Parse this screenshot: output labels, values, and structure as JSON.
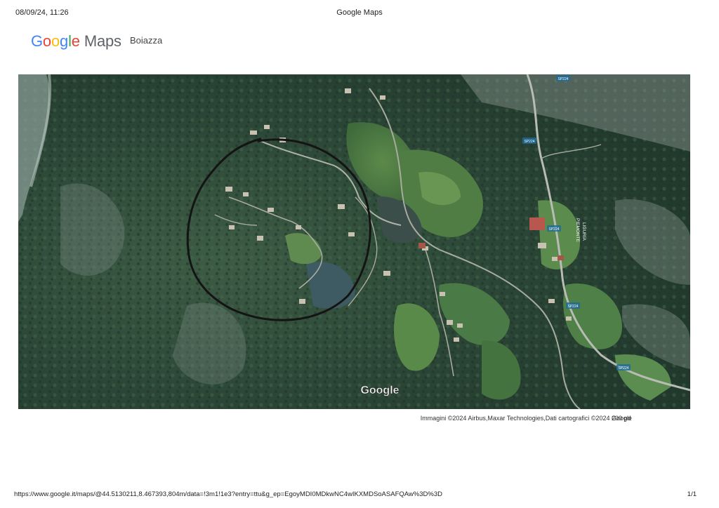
{
  "print_header": {
    "datetime": "08/09/24, 11:26",
    "title": "Google Maps"
  },
  "logo": {
    "letters": [
      "G",
      "o",
      "o",
      "g",
      "l",
      "e"
    ],
    "colors": [
      "#4285F4",
      "#EA4335",
      "#FBBC05",
      "#4285F4",
      "#34A853",
      "#EA4335"
    ],
    "maps_label": "Maps"
  },
  "place_name": "Boiazza",
  "map": {
    "watermark": "Google",
    "road_labels": [
      "SP224",
      "SP224",
      "SP224",
      "SP224",
      "SP224"
    ],
    "region_label": [
      "PIEMONTE",
      "LIGURIA"
    ],
    "marked_area": "hand-drawn circle"
  },
  "attribution": "Immagini ©2024 Airbus,Maxar Technologies,Dati cartografici ©2024 Google",
  "scale_label": "200 pd",
  "footer": {
    "url": "https://www.google.it/maps/@44.5130211,8.467393,804m/data=!3m1!1e3?entry=ttu&g_ep=EgoyMDI0MDkwNC4wIKXMDSoASAFQAw%3D%3D",
    "page": "1/1"
  }
}
